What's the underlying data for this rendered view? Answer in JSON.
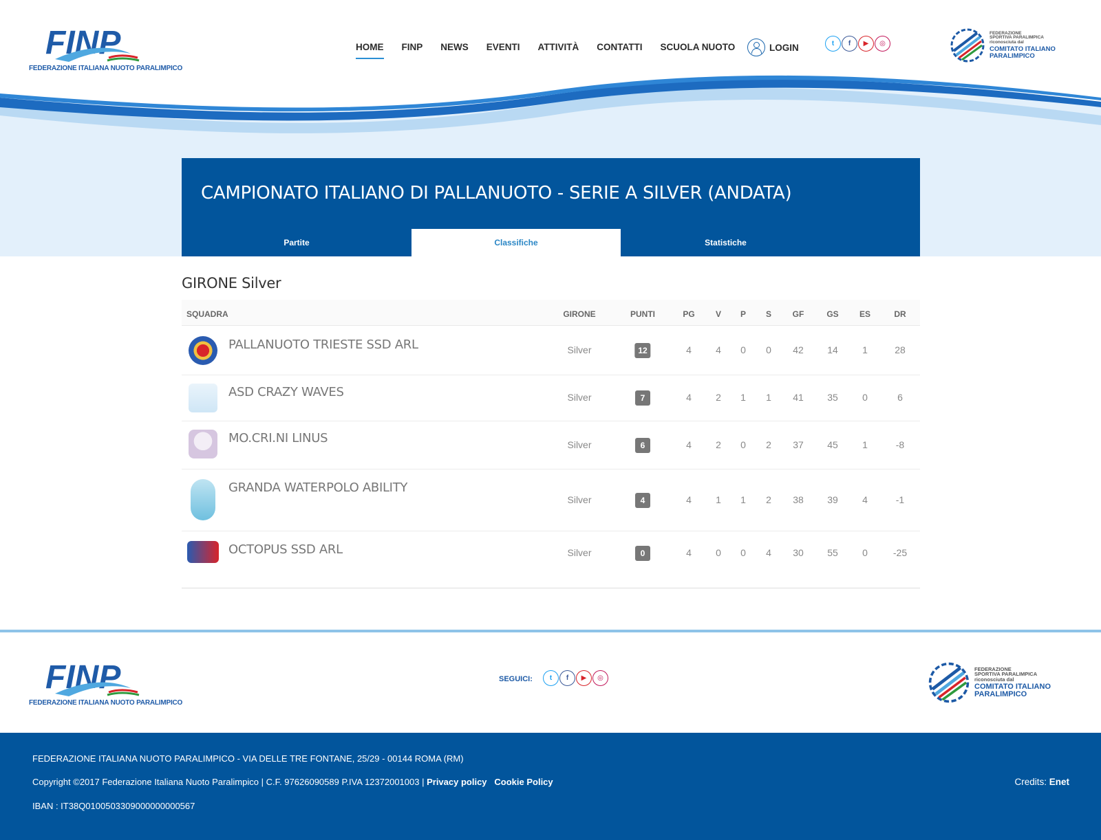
{
  "header": {
    "logo_text": "FEDERAZIONE ITALIANA NUOTO PARALIMPICO",
    "nav": [
      {
        "label": "HOME",
        "active": true
      },
      {
        "label": "FINP"
      },
      {
        "label": "NEWS"
      },
      {
        "label": "EVENTI"
      },
      {
        "label": "ATTIVITÀ"
      },
      {
        "label": "CONTATTI"
      },
      {
        "label": "SCUOLA NUOTO"
      }
    ],
    "login_label": "LOGIN",
    "social_icons": [
      "twitter-icon",
      "facebook-icon",
      "youtube-icon",
      "instagram-icon"
    ],
    "cip": {
      "line1": "FEDERAZIONE",
      "line2": "SPORTIVA PARALIMPICA",
      "line3": "riconosciuta dal",
      "line4": "COMITATO ITALIANO",
      "line5": "PARALIMPICO"
    }
  },
  "panel": {
    "title": "CAMPIONATO ITALIANO DI PALLANUOTO - SERIE A SILVER (ANDATA)",
    "tabs": [
      {
        "label": "Partite",
        "active": false
      },
      {
        "label": "Classifiche",
        "active": true
      },
      {
        "label": "Statistiche",
        "active": false
      }
    ]
  },
  "standings": {
    "section_title": "GIRONE Silver",
    "columns": [
      "SQUADRA",
      "GIRONE",
      "PUNTI",
      "PG",
      "V",
      "P",
      "S",
      "GF",
      "GS",
      "ES",
      "DR"
    ],
    "rows": [
      {
        "team": "PALLANUOTO TRIESTE SSD ARL",
        "girone": "Silver",
        "punti": "12",
        "pg": "4",
        "v": "4",
        "p": "0",
        "s": "0",
        "gf": "42",
        "gs": "14",
        "es": "1",
        "dr": "28"
      },
      {
        "team": "ASD CRAZY WAVES",
        "girone": "Silver",
        "punti": "7",
        "pg": "4",
        "v": "2",
        "p": "1",
        "s": "1",
        "gf": "41",
        "gs": "35",
        "es": "0",
        "dr": "6"
      },
      {
        "team": "MO.CRI.NI LINUS",
        "girone": "Silver",
        "punti": "6",
        "pg": "4",
        "v": "2",
        "p": "0",
        "s": "2",
        "gf": "37",
        "gs": "45",
        "es": "1",
        "dr": "-8"
      },
      {
        "team": "GRANDA WATERPOLO ABILITY",
        "girone": "Silver",
        "punti": "4",
        "pg": "4",
        "v": "1",
        "p": "1",
        "s": "2",
        "gf": "38",
        "gs": "39",
        "es": "4",
        "dr": "-1"
      },
      {
        "team": "OCTOPUS SSD ARL",
        "girone": "Silver",
        "punti": "0",
        "pg": "4",
        "v": "0",
        "p": "0",
        "s": "4",
        "gf": "30",
        "gs": "55",
        "es": "0",
        "dr": "-25"
      }
    ]
  },
  "footer": {
    "seguici_label": "SEGUICI:",
    "address": "FEDERAZIONE ITALIANA NUOTO PARALIMPICO - VIA DELLE TRE FONTANE, 25/29 - 00144 ROMA (RM)",
    "copyright": "Copyright ©2017 Federazione Italiana Nuoto Paralimpico | C.F. 97626090589 P.IVA 12372001003 |",
    "privacy_label": "Privacy policy",
    "cookie_label": "Cookie Policy",
    "iban": "IBAN : IT38Q0100503309000000000567",
    "credits_label": "Credits:",
    "credits_link": "Enet"
  },
  "colors": {
    "primary_blue": "#02559c",
    "accent_blue": "#2a86c5",
    "hero_light": "#e4f1fc",
    "badge_gray": "#777777"
  }
}
